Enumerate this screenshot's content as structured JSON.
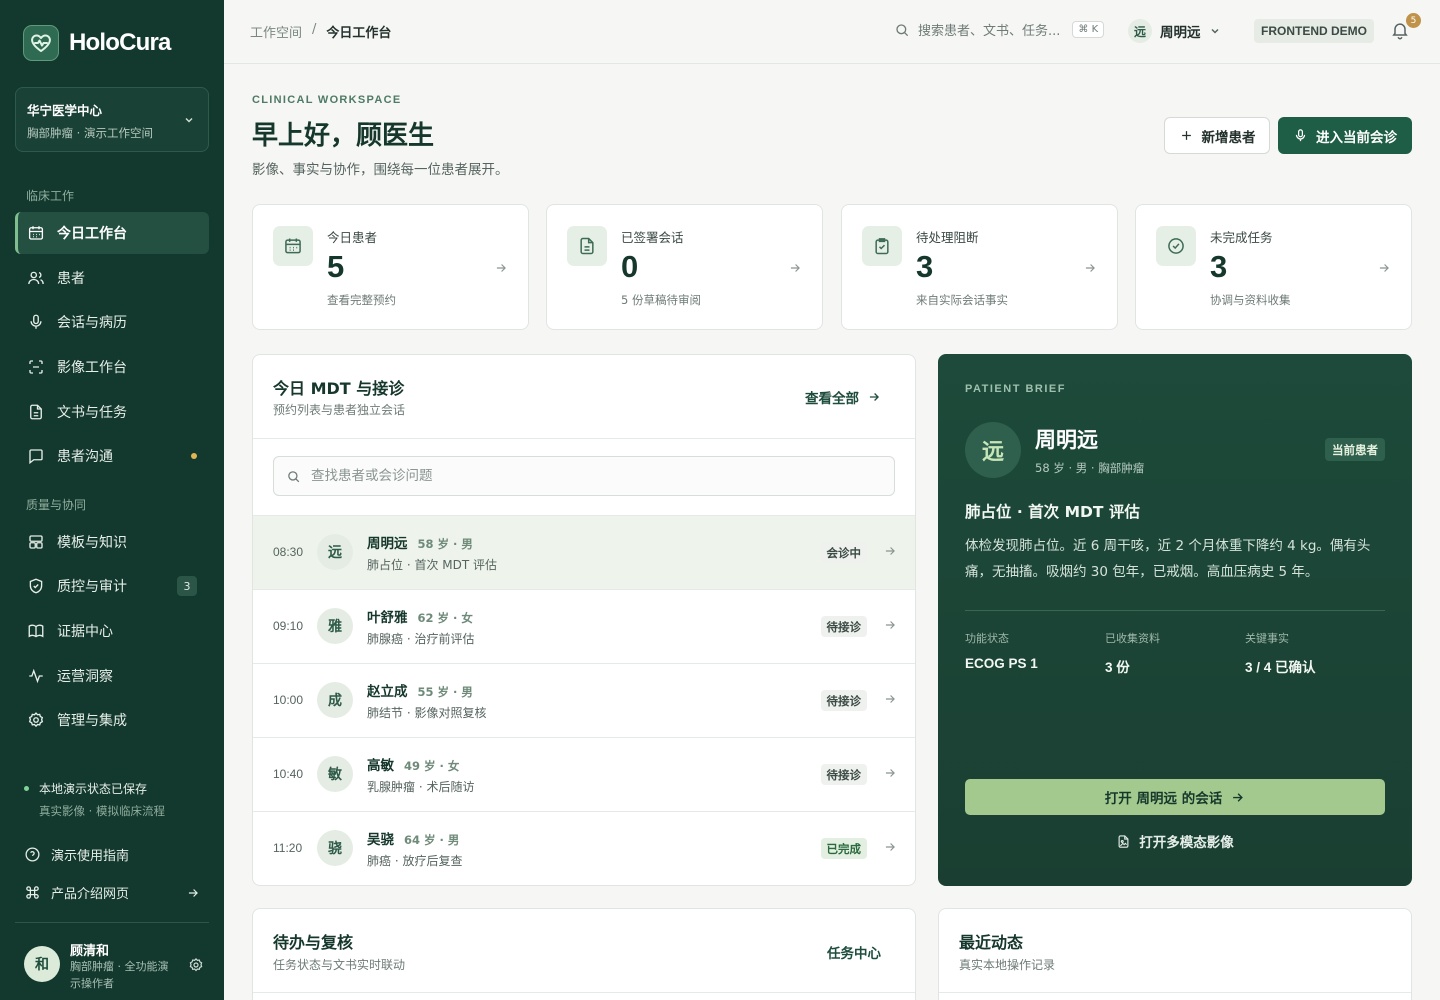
{
  "brand": {
    "name": "HoloCura"
  },
  "org": {
    "name": "华宁医学中心",
    "sub": "胸部肿瘤 · 演示工作空间"
  },
  "nav": {
    "section1": "临床工作",
    "section2": "质量与协同",
    "items": [
      {
        "label": "今日工作台",
        "icon": "calendar-icon",
        "active": true
      },
      {
        "label": "患者",
        "icon": "users-icon"
      },
      {
        "label": "会话与病历",
        "icon": "microphone-icon"
      },
      {
        "label": "影像工作台",
        "icon": "scan-icon"
      },
      {
        "label": "文书与任务",
        "icon": "document-icon"
      },
      {
        "label": "患者沟通",
        "icon": "chat-icon",
        "dot": true
      },
      {
        "label": "模板与知识",
        "icon": "template-icon"
      },
      {
        "label": "质控与审计",
        "icon": "shield-icon",
        "count": "3"
      },
      {
        "label": "证据中心",
        "icon": "book-icon"
      },
      {
        "label": "运营洞察",
        "icon": "activity-icon"
      },
      {
        "label": "管理与集成",
        "icon": "gear-icon"
      }
    ]
  },
  "sidebar_footer": {
    "save_status": "本地演示状态已保存",
    "save_sub": "真实影像 · 模拟临床流程",
    "guide": "演示使用指南",
    "product": "产品介绍网页"
  },
  "user": {
    "avatar": "和",
    "name": "顾清和",
    "role": "胸部肿瘤 · 全功能演示操作者"
  },
  "topbar": {
    "crumb_root": "工作空间",
    "crumb_sep": "/",
    "crumb_current": "今日工作台",
    "search_placeholder": "搜索患者、文书、任务...",
    "search_kbd": "⌘ K",
    "current_patient_avatar": "远",
    "current_patient": "周明远",
    "demo_badge": "FRONTEND DEMO",
    "notifications": "5"
  },
  "hero": {
    "eyebrow": "CLINICAL WORKSPACE",
    "greeting": "早上好，顾医生",
    "subtitle": "影像、事实与协作，围绕每一位患者展开。",
    "add_patient": "新增患者",
    "enter_consult": "进入当前会诊"
  },
  "stats": [
    {
      "label": "今日患者",
      "value": "5",
      "sub": "查看完整预约",
      "icon": "calendar-icon"
    },
    {
      "label": "已签署会话",
      "value": "0",
      "sub": "5 份草稿待审阅",
      "icon": "document-icon"
    },
    {
      "label": "待处理阻断",
      "value": "3",
      "sub": "来自实际会话事实",
      "icon": "clipboard-check-icon"
    },
    {
      "label": "未完成任务",
      "value": "3",
      "sub": "协调与资料收集",
      "icon": "check-circle-icon"
    }
  ],
  "schedule": {
    "title": "今日 MDT 与接诊",
    "sub": "预约列表与患者独立会话",
    "view_all": "查看全部",
    "search_placeholder": "查找患者或会诊问题",
    "rows": [
      {
        "time": "08:30",
        "avatar": "远",
        "name": "周明远",
        "meta": "58 岁 · 男",
        "diag": "肺占位 · 首次 MDT 评估",
        "status": "会诊中"
      },
      {
        "time": "09:10",
        "avatar": "雅",
        "name": "叶舒雅",
        "meta": "62 岁 · 女",
        "diag": "肺腺癌 · 治疗前评估",
        "status": "待接诊"
      },
      {
        "time": "10:00",
        "avatar": "成",
        "name": "赵立成",
        "meta": "55 岁 · 男",
        "diag": "肺结节 · 影像对照复核",
        "status": "待接诊"
      },
      {
        "time": "10:40",
        "avatar": "敏",
        "name": "高敏",
        "meta": "49 岁 · 女",
        "diag": "乳腺肿瘤 · 术后随访",
        "status": "待接诊"
      },
      {
        "time": "11:20",
        "avatar": "骁",
        "name": "吴骁",
        "meta": "64 岁 · 男",
        "diag": "肺癌 · 放疗后复查",
        "status": "已完成"
      }
    ]
  },
  "brief": {
    "eyebrow": "PATIENT BRIEF",
    "avatar": "远",
    "name": "周明远",
    "meta": "58 岁 · 男 · 胸部肿瘤",
    "tag": "当前患者",
    "title": "肺占位 · 首次 MDT 评估",
    "summary": "体检发现肺占位。近 6 周干咳，近 2 个月体重下降约 4 kg。偶有头痛，无抽搐。吸烟约 30 包年，已戒烟。高血压病史 5 年。",
    "facts": [
      {
        "k": "功能状态",
        "v": "ECOG PS 1"
      },
      {
        "k": "已收集资料",
        "v": "3 份"
      },
      {
        "k": "关键事实",
        "v": "3 / 4 已确认"
      }
    ],
    "open_session": "打开 周明远 的会话",
    "open_imaging": "打开多模态影像"
  },
  "tasks_panel": {
    "title": "待办与复核",
    "sub": "任务状态与文书实时联动",
    "link": "任务中心"
  },
  "activity_panel": {
    "title": "最近动态",
    "sub": "真实本地操作记录"
  },
  "colors": {
    "sidebar": "#13382d",
    "primary": "#1f5e46",
    "accent": "#a3c98e"
  }
}
